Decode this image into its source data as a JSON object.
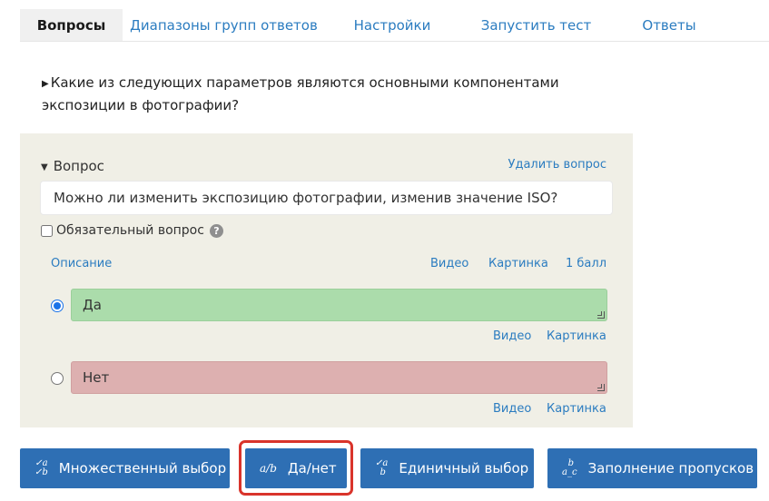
{
  "tabs": [
    {
      "label": "Вопросы",
      "active": true
    },
    {
      "label": "Диапазоны групп ответов",
      "active": false
    },
    {
      "label": "Настройки",
      "active": false
    },
    {
      "label": "Запустить тест",
      "active": false
    },
    {
      "label": "Ответы",
      "active": false
    }
  ],
  "question_title": "Какие из следующих параметров являются основными компонентами экспозиции в фотографии?",
  "panel": {
    "header": "Вопрос",
    "delete_label": "Удалить вопрос",
    "question_text": "Можно ли изменить экспозицию фотографии, изменив значение ISO?",
    "required_label": "Обязательный вопрос",
    "required_checked": false,
    "description_label": "Описание",
    "video_label": "Видео",
    "image_label": "Картинка",
    "points_label": "1 балл",
    "answers": [
      {
        "text": "Да",
        "selected": true,
        "video": "Видео",
        "image": "Картинка",
        "color": "#abdcab"
      },
      {
        "text": "Нет",
        "selected": false,
        "video": "Видео",
        "image": "Картинка",
        "color": "#ddb0b0"
      }
    ]
  },
  "buttons": [
    {
      "label": "Множественный выбор",
      "icon": "multiple-choice-icon"
    },
    {
      "label": "Да/нет",
      "icon": "yes-no-icon",
      "highlighted": true
    },
    {
      "label": "Единичный выбор",
      "icon": "single-choice-icon"
    },
    {
      "label": "Заполнение пропусков",
      "icon": "fill-blanks-icon"
    }
  ],
  "colors": {
    "accent": "#2b7cc0",
    "button_bg": "#2e6fb4",
    "panel_bg": "#f0efe6",
    "highlight": "#d9342b"
  }
}
